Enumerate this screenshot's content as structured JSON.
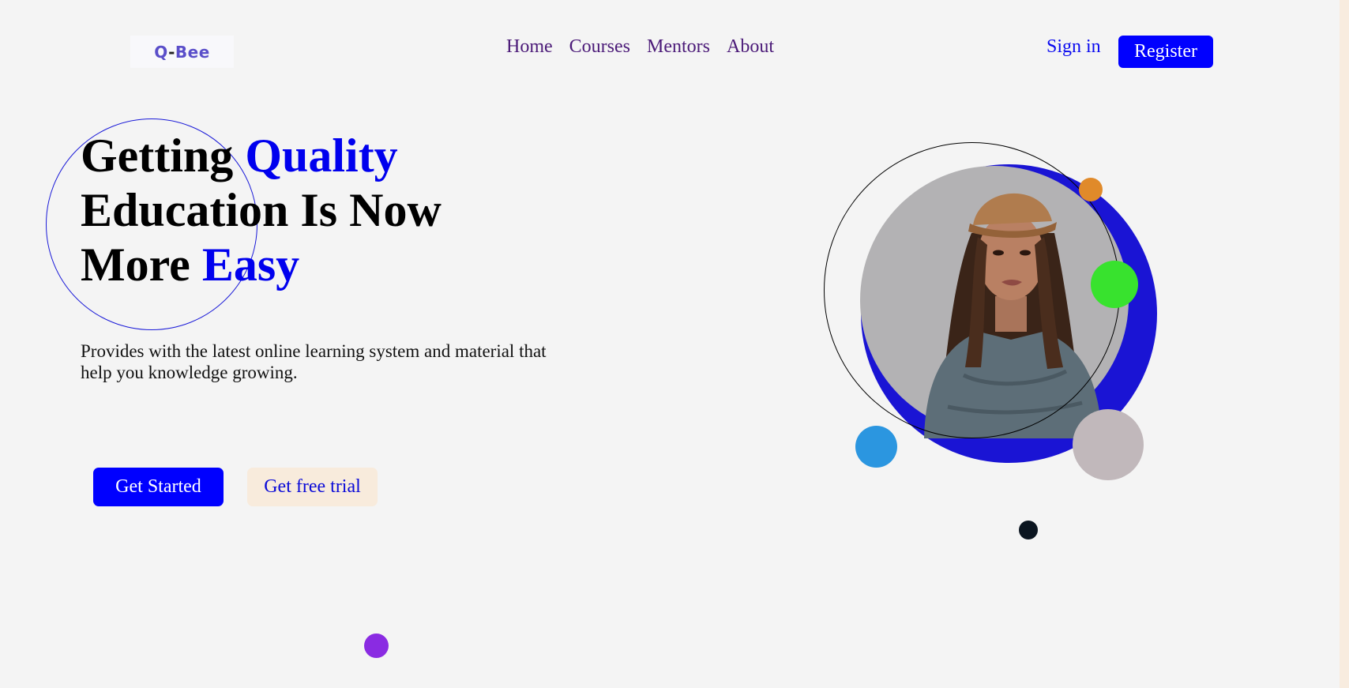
{
  "brand": {
    "logo_prefix": "Q",
    "logo_dash": "-",
    "logo_suffix": "Bee"
  },
  "nav": {
    "items": [
      {
        "label": "Home"
      },
      {
        "label": "Courses"
      },
      {
        "label": "Mentors"
      },
      {
        "label": "About"
      }
    ]
  },
  "auth": {
    "sign_in": "Sign in",
    "register": "Register"
  },
  "hero": {
    "headline_part1": "Getting ",
    "headline_accent1": "Quality",
    "headline_part2": "Education Is Now",
    "headline_part3": "More ",
    "headline_accent2": "Easy",
    "subtext": "Provides with the latest online learning system and material that help you knowledge growing.",
    "primary_cta": "Get Started",
    "secondary_cta": "Get free trial"
  },
  "colors": {
    "accent_blue": "#0000ff",
    "nav_purple": "#4b1a78",
    "trial_bg": "#f8ebdc",
    "disc_blue": "#1a14d4",
    "disc_grey": "#b3b2b4",
    "dot_orange": "#e08a2a",
    "dot_green": "#38e22e",
    "dot_sky": "#2b96e0",
    "dot_taupe": "#c1b8bb",
    "dot_navy": "#0b1520",
    "dot_purple": "#8a2be2"
  }
}
